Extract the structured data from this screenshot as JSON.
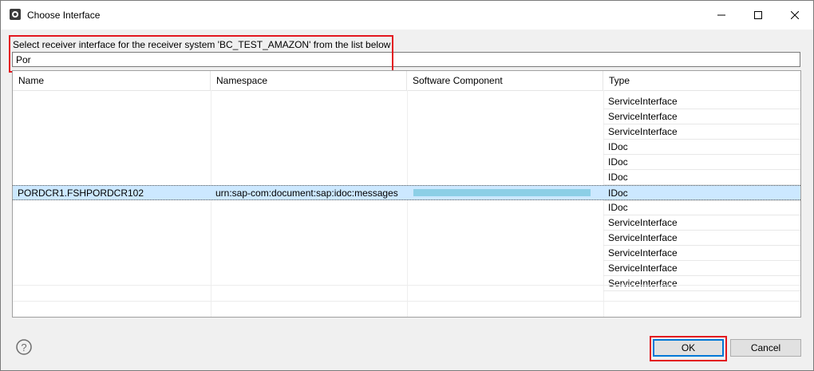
{
  "window": {
    "title": "Choose Interface",
    "minimize_icon": "minimize-icon",
    "maximize_icon": "maximize-icon",
    "close_icon": "close-icon"
  },
  "instruction": "Select receiver interface for the receiver system 'BC_TEST_AMAZON' from the list below",
  "filter": {
    "value": "Por"
  },
  "table": {
    "columns": [
      "Name",
      "Namespace",
      "Software Component",
      "Type"
    ],
    "rows": [
      {
        "name": "",
        "namespace": "",
        "type": "ServiceInterface"
      },
      {
        "name": "",
        "namespace": "",
        "type": "ServiceInterface"
      },
      {
        "name": "",
        "namespace": "",
        "type": "ServiceInterface"
      },
      {
        "name": "",
        "namespace": "",
        "type": "IDoc"
      },
      {
        "name": "",
        "namespace": "",
        "type": "IDoc"
      },
      {
        "name": "",
        "namespace": "",
        "type": "IDoc"
      },
      {
        "name": "PORDCR1.FSHPORDCR102",
        "namespace": "urn:sap-com:document:sap:idoc:messages",
        "type": "IDoc",
        "selected": true
      },
      {
        "name": "",
        "namespace": "",
        "type": "IDoc"
      },
      {
        "name": "",
        "namespace": "",
        "type": "ServiceInterface"
      },
      {
        "name": "",
        "namespace": "",
        "type": "ServiceInterface"
      },
      {
        "name": "",
        "namespace": "",
        "type": "ServiceInterface"
      },
      {
        "name": "",
        "namespace": "",
        "type": "ServiceInterface"
      },
      {
        "name": "",
        "namespace": "",
        "type": "ServiceInterface"
      }
    ]
  },
  "buttons": {
    "ok": "OK",
    "cancel": "Cancel"
  },
  "icons": {
    "help": "help-icon",
    "app": "app-icon"
  },
  "colors": {
    "highlight": "#e3171f",
    "selection": "#cce8ff",
    "focus": "#0078d7"
  }
}
